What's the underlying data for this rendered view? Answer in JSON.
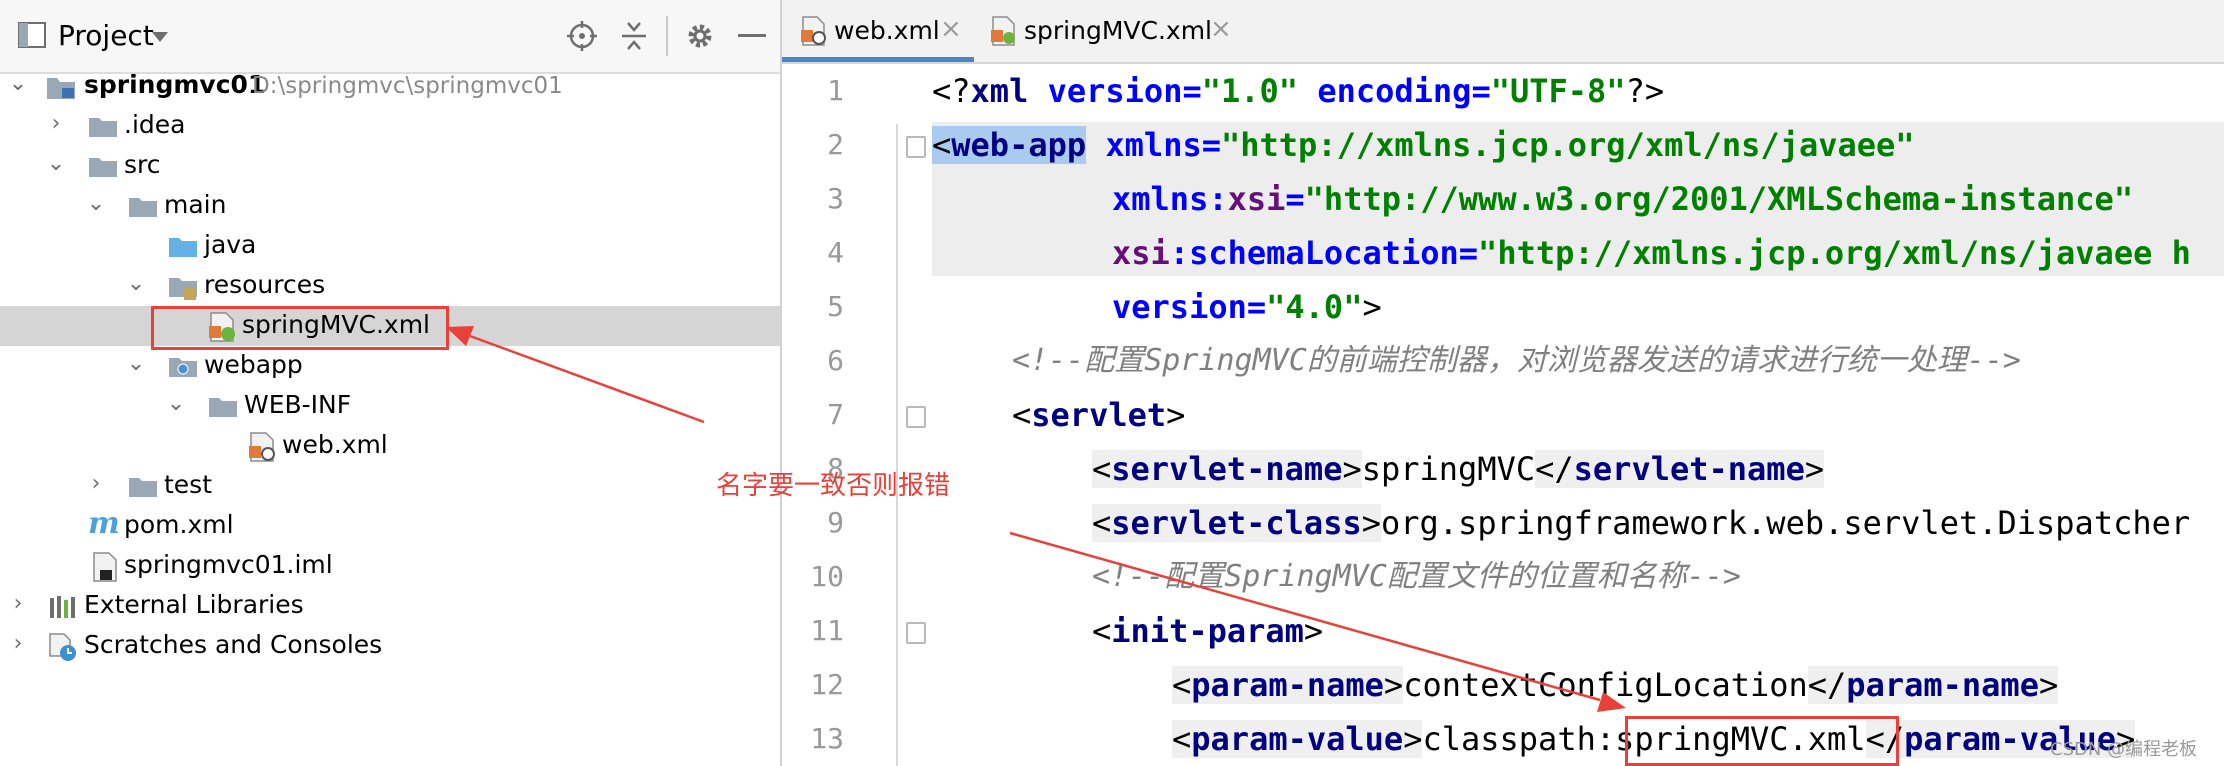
{
  "project_panel": {
    "title": "Project",
    "tree": [
      {
        "label": "springmvc01",
        "path": "D:\\springmvc\\springmvc01",
        "arrow": "down",
        "icon": "module-folder-icon"
      },
      {
        "label": ".idea",
        "arrow": "right",
        "icon": "folder-icon"
      },
      {
        "label": "src",
        "arrow": "down",
        "icon": "folder-icon"
      },
      {
        "label": "main",
        "arrow": "down",
        "icon": "folder-icon"
      },
      {
        "label": "java",
        "arrow": "",
        "icon": "source-folder-icon"
      },
      {
        "label": "resources",
        "arrow": "down",
        "icon": "resources-folder-icon"
      },
      {
        "label": "springMVC.xml",
        "arrow": "",
        "icon": "spring-xml-icon"
      },
      {
        "label": "webapp",
        "arrow": "down",
        "icon": "web-folder-icon"
      },
      {
        "label": "WEB-INF",
        "arrow": "down",
        "icon": "folder-icon"
      },
      {
        "label": "web.xml",
        "arrow": "",
        "icon": "web-xml-icon"
      },
      {
        "label": "test",
        "arrow": "right",
        "icon": "folder-icon"
      },
      {
        "label": "pom.xml",
        "arrow": "",
        "icon": "maven-icon"
      },
      {
        "label": "springmvc01.iml",
        "arrow": "",
        "icon": "iml-file-icon"
      },
      {
        "label": "External Libraries",
        "arrow": "right",
        "icon": "libraries-icon"
      },
      {
        "label": "Scratches and Consoles",
        "arrow": "right",
        "icon": "scratches-icon"
      }
    ]
  },
  "editor": {
    "tabs": [
      {
        "label": "web.xml",
        "active": true
      },
      {
        "label": "springMVC.xml",
        "active": false
      }
    ],
    "line_numbers": [
      "1",
      "2",
      "3",
      "4",
      "5",
      "6",
      "7",
      "8",
      "9",
      "10",
      "11",
      "12",
      "13"
    ],
    "lines": {
      "l1": {
        "p1": "<?",
        "p2": "xml",
        "p3": " version",
        "p4": "=",
        "p5": "\"1.0\"",
        "p6": " encoding",
        "p7": "=",
        "p8": "\"UTF-8\"",
        "p9": "?>"
      },
      "l2": {
        "p1": "<",
        "p2": "web-app",
        "p3": " ",
        "p4": "xmlns",
        "p5": "=",
        "p6": "\"http://xmlns.jcp.org/xml/ns/javaee\""
      },
      "l3": {
        "p1": "xmlns:",
        "p2": "xsi",
        "p3": "=",
        "p4": "\"http://www.w3.org/2001/XMLSchema-instance\""
      },
      "l4": {
        "p1": "xsi",
        "p2": ":schemaLocation",
        "p3": "=",
        "p4": "\"http://xmlns.jcp.org/xml/ns/javaee h"
      },
      "l5": {
        "p1": "version",
        "p2": "=",
        "p3": "\"4.0\"",
        "p4": ">"
      },
      "l6": {
        "p1": "<!--配置SpringMVC的前端控制器，对浏览器发送的请求进行统一处理-->"
      },
      "l7": {
        "p1": "<",
        "p2": "servlet",
        "p3": ">"
      },
      "l8": {
        "p1": "<",
        "p2": "servlet-name",
        "p3": ">",
        "p4": "springMVC",
        "p5": "</",
        "p6": "servlet-name",
        "p7": ">"
      },
      "l9": {
        "p1": "<",
        "p2": "servlet-class",
        "p3": ">",
        "p4": "org.springframework.web.servlet.Dispatcher"
      },
      "l10": {
        "p1": "<!--配置SpringMVC配置文件的位置和名称-->"
      },
      "l11": {
        "p1": "<",
        "p2": "init-param",
        "p3": ">"
      },
      "l12": {
        "p1": "<",
        "p2": "param-name",
        "p3": ">",
        "p4": "contextConfigLocation",
        "p5": "</",
        "p6": "param-name",
        "p7": ">"
      },
      "l13": {
        "p1": "<",
        "p2": "param-value",
        "p3": ">",
        "p4": "classpath:",
        "p5": "springMVC.xml",
        "p6": "</",
        "p7": "param-value",
        "p8": ">"
      }
    }
  },
  "annotation": {
    "text": "名字要一致否则报错",
    "color": "#e8413a"
  },
  "watermark": "CSDN @编程老板"
}
